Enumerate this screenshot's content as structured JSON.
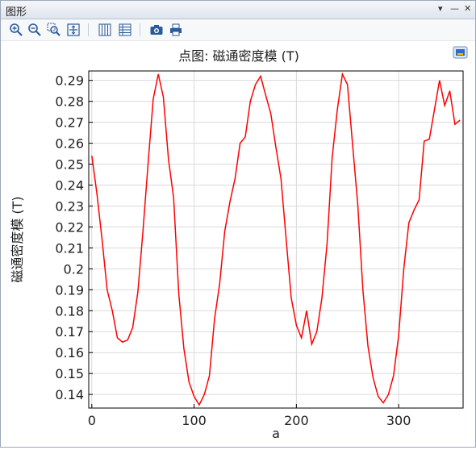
{
  "window": {
    "title": "图形",
    "controls": {
      "dropdown": "▾",
      "minimize": "—",
      "close": "✕"
    }
  },
  "toolbar": {
    "buttons": [
      {
        "icon": "zoom-in-icon"
      },
      {
        "icon": "zoom-out-icon"
      },
      {
        "icon": "zoom-box-icon"
      },
      {
        "icon": "zoom-extents-icon"
      },
      {
        "icon": "grid-icon"
      },
      {
        "icon": "table-icon"
      },
      {
        "icon": "camera-icon"
      },
      {
        "icon": "print-icon"
      }
    ]
  },
  "colors": {
    "series": "#ff0000",
    "grid": "#d9d9d9",
    "axis": "#000000"
  },
  "chart_data": {
    "type": "line",
    "title": "点图: 磁通密度模 (T)",
    "xlabel": "a",
    "ylabel": "磁通密度模 (T)",
    "xlim": [
      -3,
      363
    ],
    "ylim": [
      0.1335,
      0.2945
    ],
    "xticks": [
      0,
      100,
      200,
      300
    ],
    "yticks": [
      0.14,
      0.15,
      0.16,
      0.17,
      0.18,
      0.19,
      0.2,
      0.21,
      0.22,
      0.23,
      0.24,
      0.25,
      0.26,
      0.27,
      0.28,
      0.29
    ],
    "ytick_labels": [
      "0.14",
      "0.15",
      "0.16",
      "0.17",
      "0.18",
      "0.19",
      "0.2",
      "0.21",
      "0.22",
      "0.23",
      "0.24",
      "0.25",
      "0.26",
      "0.27",
      "0.28",
      "0.29"
    ],
    "grid": true,
    "series": [
      {
        "x": [
          0,
          5,
          10,
          15,
          20,
          25,
          30,
          35,
          40,
          45,
          50,
          55,
          60,
          65,
          70,
          75,
          80,
          85,
          90,
          95,
          100,
          105,
          110,
          115,
          120,
          125,
          130,
          135,
          140,
          145,
          150,
          155,
          160,
          165,
          170,
          175,
          180,
          185,
          190,
          195,
          200,
          205,
          210,
          215,
          220,
          225,
          230,
          235,
          240,
          245,
          250,
          255,
          260,
          265,
          270,
          275,
          280,
          285,
          290,
          295,
          300,
          305,
          310,
          315,
          320,
          325,
          330,
          335,
          340,
          345,
          350,
          355,
          360
        ],
        "y": [
          0.254,
          0.236,
          0.214,
          0.19,
          0.18,
          0.167,
          0.165,
          0.166,
          0.172,
          0.189,
          0.218,
          0.25,
          0.281,
          0.293,
          0.282,
          0.252,
          0.234,
          0.188,
          0.162,
          0.146,
          0.139,
          0.135,
          0.14,
          0.149,
          0.176,
          0.193,
          0.218,
          0.232,
          0.243,
          0.26,
          0.263,
          0.28,
          0.288,
          0.292,
          0.283,
          0.274,
          0.258,
          0.243,
          0.214,
          0.186,
          0.173,
          0.167,
          0.18,
          0.164,
          0.17,
          0.186,
          0.212,
          0.253,
          0.276,
          0.293,
          0.288,
          0.259,
          0.231,
          0.19,
          0.163,
          0.148,
          0.139,
          0.136,
          0.14,
          0.149,
          0.168,
          0.2,
          0.222,
          0.228,
          0.233,
          0.261,
          0.262,
          0.276,
          0.29,
          0.278,
          0.285,
          0.269,
          0.271
        ]
      }
    ]
  }
}
